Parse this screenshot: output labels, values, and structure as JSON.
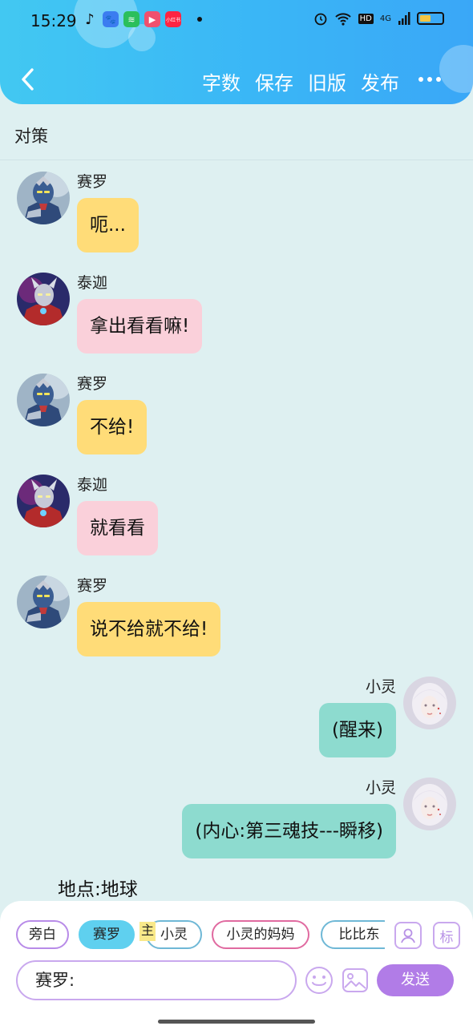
{
  "status": {
    "time": "15:29",
    "app_icons": [
      {
        "name": "tiktok-icon",
        "glyph": "♪",
        "color": "#111111"
      },
      {
        "name": "baidu-icon",
        "glyph": "🐾",
        "color": "#3b7df0"
      },
      {
        "name": "wechat-mini-icon",
        "glyph": "≋",
        "color": "#2bbf5c"
      },
      {
        "name": "video-app-icon",
        "glyph": "▶",
        "color": "#f0506e"
      },
      {
        "name": "xiaohongshu-icon",
        "glyph": "小红书",
        "color": "#ff2442"
      }
    ],
    "network": "4G",
    "hd": "HD",
    "battery_level": 0.5
  },
  "nav": {
    "actions": [
      "字数",
      "保存",
      "旧版",
      "发布"
    ]
  },
  "chat": {
    "title": "对策",
    "messages": [
      {
        "side": "left",
        "name": "赛罗",
        "text": "呃...",
        "color": "yellow",
        "avatar": "zero"
      },
      {
        "side": "left",
        "name": "泰迦",
        "text": "拿出看看嘛!",
        "color": "pink",
        "avatar": "taiga"
      },
      {
        "side": "left",
        "name": "赛罗",
        "text": "不给!",
        "color": "yellow",
        "avatar": "zero"
      },
      {
        "side": "left",
        "name": "泰迦",
        "text": "就看看",
        "color": "pink",
        "avatar": "taiga"
      },
      {
        "side": "left",
        "name": "赛罗",
        "text": "说不给就不给!",
        "color": "yellow",
        "avatar": "zero"
      },
      {
        "side": "right",
        "name": "小灵",
        "text": "(醒来)",
        "color": "teal",
        "avatar": "xiaoling"
      },
      {
        "side": "right",
        "name": "小灵",
        "text": "(内心:第三魂技---瞬移)",
        "color": "teal",
        "avatar": "xiaoling"
      }
    ],
    "location": "地点:地球"
  },
  "composer": {
    "roles": [
      {
        "label": "旁白",
        "style": "default"
      },
      {
        "label": "赛罗",
        "style": "active"
      },
      {
        "label": "小灵",
        "style": "teal"
      },
      {
        "label": "小灵的妈妈",
        "style": "pink"
      },
      {
        "label": "比比东",
        "style": "teal"
      }
    ],
    "main_tag": "主",
    "tag_icon_label": "标",
    "input_value": "赛罗:",
    "send_label": "发送"
  }
}
